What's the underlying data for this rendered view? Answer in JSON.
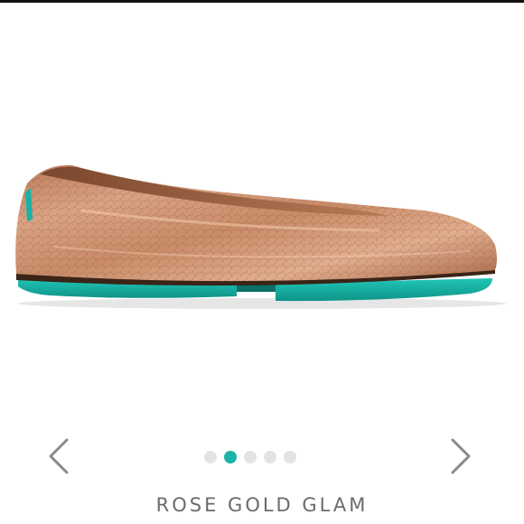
{
  "product": {
    "name": "ROSE GOLD GLAM",
    "image_icon": "rose-gold-ballet-flat"
  },
  "carousel": {
    "prev_icon": "chevron-left-icon",
    "next_icon": "chevron-right-icon",
    "slide_count": 5,
    "active_index": 1
  },
  "colors": {
    "leather": "#c98c6a",
    "leather_dark": "#8a5436",
    "sole": "#1ab3a6",
    "dot_active": "#1ab3a6",
    "dot_inactive": "#e3e3e3",
    "caption": "#6b6b6b",
    "arrow": "#8a8a8a"
  }
}
